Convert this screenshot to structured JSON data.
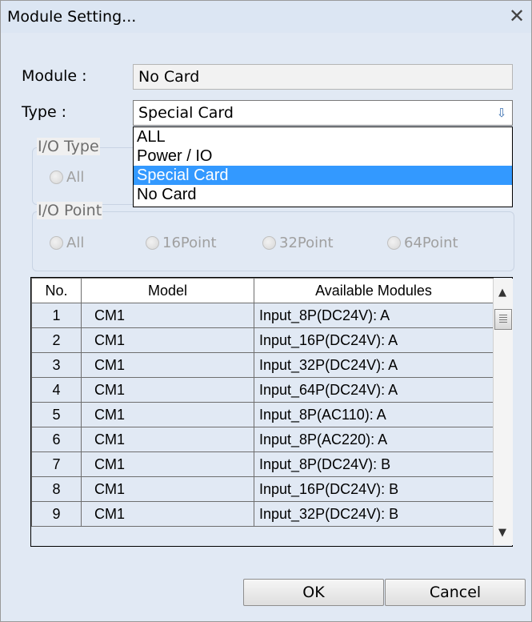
{
  "window": {
    "title": "Module Setting...",
    "close_label": "✕"
  },
  "module": {
    "label": "Module :",
    "value": "No Card"
  },
  "type": {
    "label": "Type :",
    "value": "Special Card",
    "dropdown_arrow": "⇩"
  },
  "dropdown": {
    "options": [
      "ALL",
      "Power / IO",
      "Special Card",
      "No Card"
    ],
    "selected": "Special Card"
  },
  "io_type": {
    "label": "I/O Type",
    "options": [
      "All"
    ]
  },
  "io_point": {
    "label": "I/O Point",
    "options": [
      "All",
      "16Point",
      "32Point",
      "64Point"
    ]
  },
  "table": {
    "headers": [
      "No.",
      "Model",
      "Available Modules"
    ],
    "rows": [
      [
        "1",
        "CM1",
        "Input_8P(DC24V): A"
      ],
      [
        "2",
        "CM1",
        "Input_16P(DC24V): A"
      ],
      [
        "3",
        "CM1",
        "Input_32P(DC24V): A"
      ],
      [
        "4",
        "CM1",
        "Input_64P(DC24V): A"
      ],
      [
        "5",
        "CM1",
        "Input_8P(AC110): A"
      ],
      [
        "6",
        "CM1",
        "Input_8P(AC220): A"
      ],
      [
        "7",
        "CM1",
        "Input_8P(DC24V): B"
      ],
      [
        "8",
        "CM1",
        "Input_16P(DC24V): B"
      ],
      [
        "9",
        "CM1",
        "Input_32P(DC24V): B"
      ]
    ]
  },
  "buttons": {
    "ok": "OK",
    "cancel": "Cancel"
  },
  "colors": {
    "selection": "#3399ff",
    "title_bar": "#dce6f3"
  }
}
